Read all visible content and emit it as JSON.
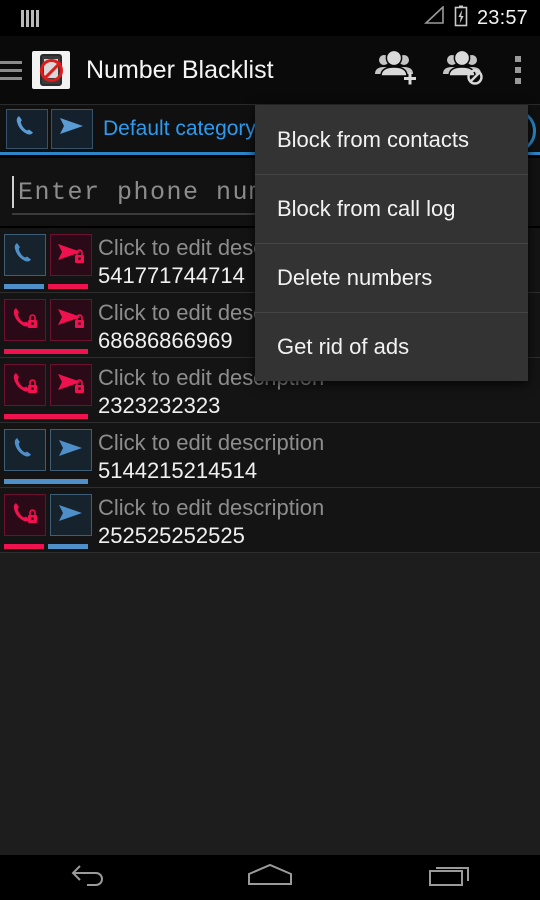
{
  "statusbar": {
    "left_icon": "notification-bars-icon",
    "signal_icon": "signal-triangle-icon",
    "battery_icon": "battery-charging-icon",
    "time": "23:57"
  },
  "actionbar": {
    "menu_icon": "hamburger-menu-icon",
    "app_icon": "blacklist-app-icon",
    "title": "Number Blacklist",
    "actions": [
      {
        "name": "add-group-button",
        "icon": "group-add-icon"
      },
      {
        "name": "block-group-button",
        "icon": "group-block-icon"
      }
    ],
    "overflow_icon": "overflow-menu-icon"
  },
  "category": {
    "call_icon": "phone-icon",
    "sms_icon": "sms-send-icon",
    "label": "Default category",
    "spinner_icon": "category-spinner-icon"
  },
  "input": {
    "placeholder": "Enter phone numb",
    "value": ""
  },
  "list": {
    "rows": [
      {
        "description": "Click to edit description",
        "number": "541771744714",
        "call_blocked": false,
        "sms_blocked": true
      },
      {
        "description": "Click to edit description",
        "number": "68686866969",
        "call_blocked": true,
        "sms_blocked": true
      },
      {
        "description": "Click to edit description",
        "number": "2323232323",
        "call_blocked": true,
        "sms_blocked": true
      },
      {
        "description": "Click to edit description",
        "number": "5144215214514",
        "call_blocked": false,
        "sms_blocked": false
      },
      {
        "description": "Click to edit description",
        "number": "252525252525",
        "call_blocked": true,
        "sms_blocked": false
      }
    ]
  },
  "popup_menu": {
    "items": [
      {
        "label": "Block from contacts"
      },
      {
        "label": "Block from call log"
      },
      {
        "label": "Delete numbers"
      },
      {
        "label": "Get rid of ads"
      }
    ]
  },
  "navbar": {
    "back_icon": "back-icon",
    "home_icon": "home-icon",
    "recents_icon": "recents-icon"
  },
  "colors": {
    "accent_blue": "#2b9bf0",
    "blocked_red": "#f0114f",
    "menu_bg": "#333333",
    "row_bg": "#141414"
  }
}
